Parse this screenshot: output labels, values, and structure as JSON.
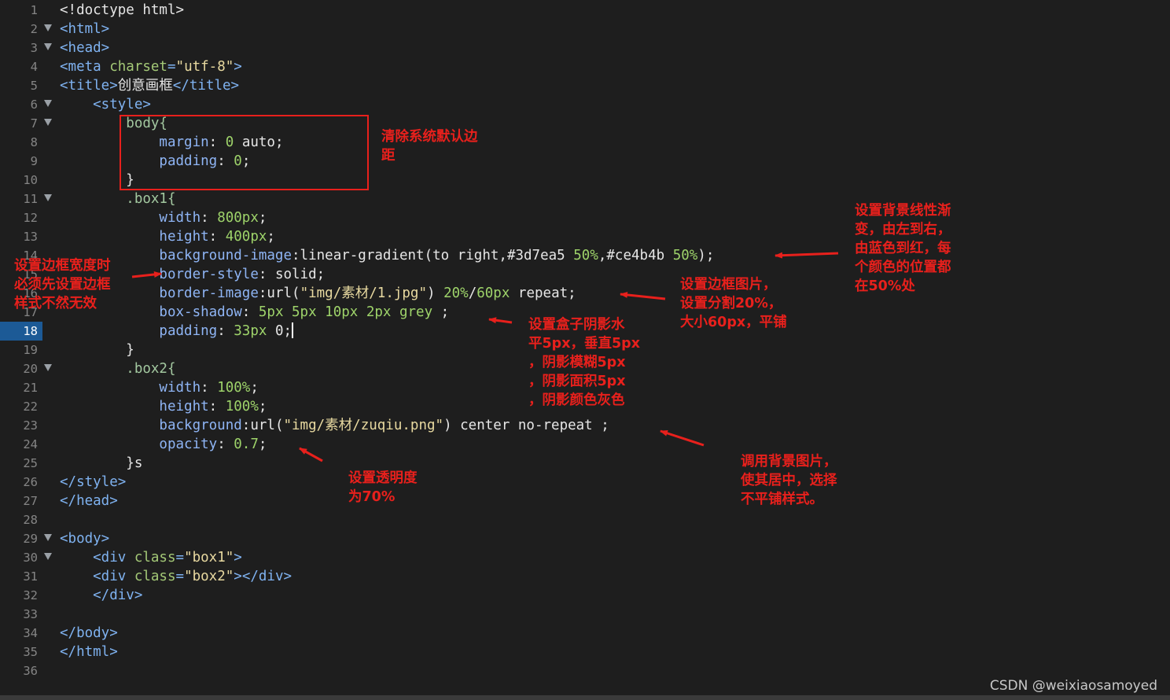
{
  "editor": {
    "active_line": 18,
    "lines": [
      {
        "n": "1",
        "fold": false,
        "tokens": [
          {
            "t": "<!doctype html>",
            "c": "plain"
          }
        ]
      },
      {
        "n": "2",
        "fold": true,
        "tokens": [
          {
            "t": "<html>",
            "c": "tag"
          }
        ]
      },
      {
        "n": "3",
        "fold": true,
        "tokens": [
          {
            "t": "<head>",
            "c": "tag"
          }
        ]
      },
      {
        "n": "4",
        "fold": false,
        "tokens": [
          {
            "t": "<meta ",
            "c": "tag"
          },
          {
            "t": "charset",
            "c": "attr"
          },
          {
            "t": "=",
            "c": "tag"
          },
          {
            "t": "\"utf-8\"",
            "c": "str"
          },
          {
            "t": ">",
            "c": "tag"
          }
        ]
      },
      {
        "n": "5",
        "fold": false,
        "tokens": [
          {
            "t": "<title>",
            "c": "tag"
          },
          {
            "t": "创意画框",
            "c": "text"
          },
          {
            "t": "</title>",
            "c": "tag"
          }
        ]
      },
      {
        "n": "6",
        "fold": true,
        "tokens": [
          {
            "t": "    <style>",
            "c": "tag"
          }
        ]
      },
      {
        "n": "7",
        "fold": true,
        "tokens": [
          {
            "t": "        body{",
            "c": "sel"
          }
        ]
      },
      {
        "n": "8",
        "fold": false,
        "tokens": [
          {
            "t": "            margin",
            "c": "prop"
          },
          {
            "t": ": ",
            "c": "val"
          },
          {
            "t": "0",
            "c": "num"
          },
          {
            "t": " auto;",
            "c": "val"
          }
        ]
      },
      {
        "n": "9",
        "fold": false,
        "tokens": [
          {
            "t": "            padding",
            "c": "prop"
          },
          {
            "t": ": ",
            "c": "val"
          },
          {
            "t": "0",
            "c": "num"
          },
          {
            "t": ";",
            "c": "val"
          }
        ]
      },
      {
        "n": "10",
        "fold": false,
        "tokens": [
          {
            "t": "        }",
            "c": "val"
          }
        ]
      },
      {
        "n": "11",
        "fold": true,
        "tokens": [
          {
            "t": "        .box1{",
            "c": "sel"
          }
        ]
      },
      {
        "n": "12",
        "fold": false,
        "tokens": [
          {
            "t": "            width",
            "c": "prop"
          },
          {
            "t": ": ",
            "c": "val"
          },
          {
            "t": "800px",
            "c": "num"
          },
          {
            "t": ";",
            "c": "val"
          }
        ]
      },
      {
        "n": "13",
        "fold": false,
        "tokens": [
          {
            "t": "            height",
            "c": "prop"
          },
          {
            "t": ": ",
            "c": "val"
          },
          {
            "t": "400px",
            "c": "num"
          },
          {
            "t": ";",
            "c": "val"
          }
        ]
      },
      {
        "n": "14",
        "fold": false,
        "tokens": [
          {
            "t": "            background-image",
            "c": "prop"
          },
          {
            "t": ":linear-gradient(to right,#3d7ea5 ",
            "c": "val"
          },
          {
            "t": "50%",
            "c": "num"
          },
          {
            "t": ",#ce4b4b ",
            "c": "val"
          },
          {
            "t": "50%",
            "c": "num"
          },
          {
            "t": ");",
            "c": "val"
          }
        ]
      },
      {
        "n": "15",
        "fold": false,
        "tokens": [
          {
            "t": "            border-style",
            "c": "prop"
          },
          {
            "t": ": solid;",
            "c": "val"
          }
        ]
      },
      {
        "n": "16",
        "fold": false,
        "tokens": [
          {
            "t": "            border-image",
            "c": "prop"
          },
          {
            "t": ":url(",
            "c": "val"
          },
          {
            "t": "\"img/素材/1.jpg\"",
            "c": "str"
          },
          {
            "t": ") ",
            "c": "val"
          },
          {
            "t": "20%",
            "c": "num"
          },
          {
            "t": "/",
            "c": "val"
          },
          {
            "t": "60px",
            "c": "num"
          },
          {
            "t": " repeat;",
            "c": "val"
          }
        ]
      },
      {
        "n": "17",
        "fold": false,
        "tokens": [
          {
            "t": "            box-shadow",
            "c": "prop"
          },
          {
            "t": ": ",
            "c": "val"
          },
          {
            "t": "5px 5px 10px 2px grey",
            "c": "num"
          },
          {
            "t": " ;",
            "c": "val"
          }
        ]
      },
      {
        "n": "18",
        "fold": false,
        "tokens": [
          {
            "t": "            padding",
            "c": "prop"
          },
          {
            "t": ": ",
            "c": "val"
          },
          {
            "t": "33px",
            "c": "num"
          },
          {
            "t": " 0;",
            "c": "val"
          }
        ]
      },
      {
        "n": "19",
        "fold": false,
        "tokens": [
          {
            "t": "        }",
            "c": "val"
          }
        ]
      },
      {
        "n": "20",
        "fold": true,
        "tokens": [
          {
            "t": "        .box2{",
            "c": "sel"
          }
        ]
      },
      {
        "n": "21",
        "fold": false,
        "tokens": [
          {
            "t": "            width",
            "c": "prop"
          },
          {
            "t": ": ",
            "c": "val"
          },
          {
            "t": "100%",
            "c": "num"
          },
          {
            "t": ";",
            "c": "val"
          }
        ]
      },
      {
        "n": "22",
        "fold": false,
        "tokens": [
          {
            "t": "            height",
            "c": "prop"
          },
          {
            "t": ": ",
            "c": "val"
          },
          {
            "t": "100%",
            "c": "num"
          },
          {
            "t": ";",
            "c": "val"
          }
        ]
      },
      {
        "n": "23",
        "fold": false,
        "tokens": [
          {
            "t": "            background",
            "c": "prop"
          },
          {
            "t": ":url(",
            "c": "val"
          },
          {
            "t": "\"img/素材/zuqiu.png\"",
            "c": "str"
          },
          {
            "t": ") center no-repeat ;",
            "c": "val"
          }
        ]
      },
      {
        "n": "24",
        "fold": false,
        "tokens": [
          {
            "t": "            opacity",
            "c": "prop"
          },
          {
            "t": ": ",
            "c": "val"
          },
          {
            "t": "0.7",
            "c": "num"
          },
          {
            "t": ";",
            "c": "val"
          }
        ]
      },
      {
        "n": "25",
        "fold": false,
        "tokens": [
          {
            "t": "        }s",
            "c": "val"
          }
        ]
      },
      {
        "n": "26",
        "fold": false,
        "tokens": [
          {
            "t": "</style>",
            "c": "tag"
          }
        ]
      },
      {
        "n": "27",
        "fold": false,
        "tokens": [
          {
            "t": "</head>",
            "c": "tag"
          }
        ]
      },
      {
        "n": "28",
        "fold": false,
        "tokens": []
      },
      {
        "n": "29",
        "fold": true,
        "tokens": [
          {
            "t": "<body>",
            "c": "tag"
          }
        ]
      },
      {
        "n": "30",
        "fold": true,
        "tokens": [
          {
            "t": "    <div ",
            "c": "tag"
          },
          {
            "t": "class",
            "c": "attr"
          },
          {
            "t": "=",
            "c": "tag"
          },
          {
            "t": "\"box1\"",
            "c": "str"
          },
          {
            "t": ">",
            "c": "tag"
          }
        ]
      },
      {
        "n": "31",
        "fold": false,
        "tokens": [
          {
            "t": "    <div ",
            "c": "tag"
          },
          {
            "t": "class",
            "c": "attr"
          },
          {
            "t": "=",
            "c": "tag"
          },
          {
            "t": "\"box2\"",
            "c": "str"
          },
          {
            "t": "></div>",
            "c": "tag"
          }
        ]
      },
      {
        "n": "32",
        "fold": false,
        "tokens": [
          {
            "t": "    </div>",
            "c": "tag"
          }
        ]
      },
      {
        "n": "33",
        "fold": false,
        "tokens": []
      },
      {
        "n": "34",
        "fold": false,
        "tokens": [
          {
            "t": "</body>",
            "c": "tag"
          }
        ]
      },
      {
        "n": "35",
        "fold": false,
        "tokens": [
          {
            "t": "</html>",
            "c": "tag"
          }
        ]
      },
      {
        "n": "36",
        "fold": false,
        "tokens": []
      }
    ]
  },
  "annotations": {
    "body_margin": "清除系统默认边\n距",
    "border_style": "设置边框宽度时\n必须先设置边框\n样式不然无效",
    "bg_gradient": "设置背景线性渐\n变，由左到右，\n由蓝色到红，每\n个颜色的位置都\n在50%处",
    "border_image": "设置边框图片，\n设置分割20%，\n大小60px，平铺",
    "box_shadow": "设置盒子阴影水\n平5px，垂直5px\n，阴影模糊5px\n，阴影面积5px\n，阴影颜色灰色",
    "opacity": "设置透明度\n为70%",
    "bg_image": "调用背景图片，\n使其居中，选择\n不平铺样式。"
  },
  "watermark": "CSDN @weixiaosamoyed",
  "colors": {
    "annotation": "#e8201c",
    "active_line_gutter": "#1c5a96",
    "background": "#1e1e1e"
  }
}
